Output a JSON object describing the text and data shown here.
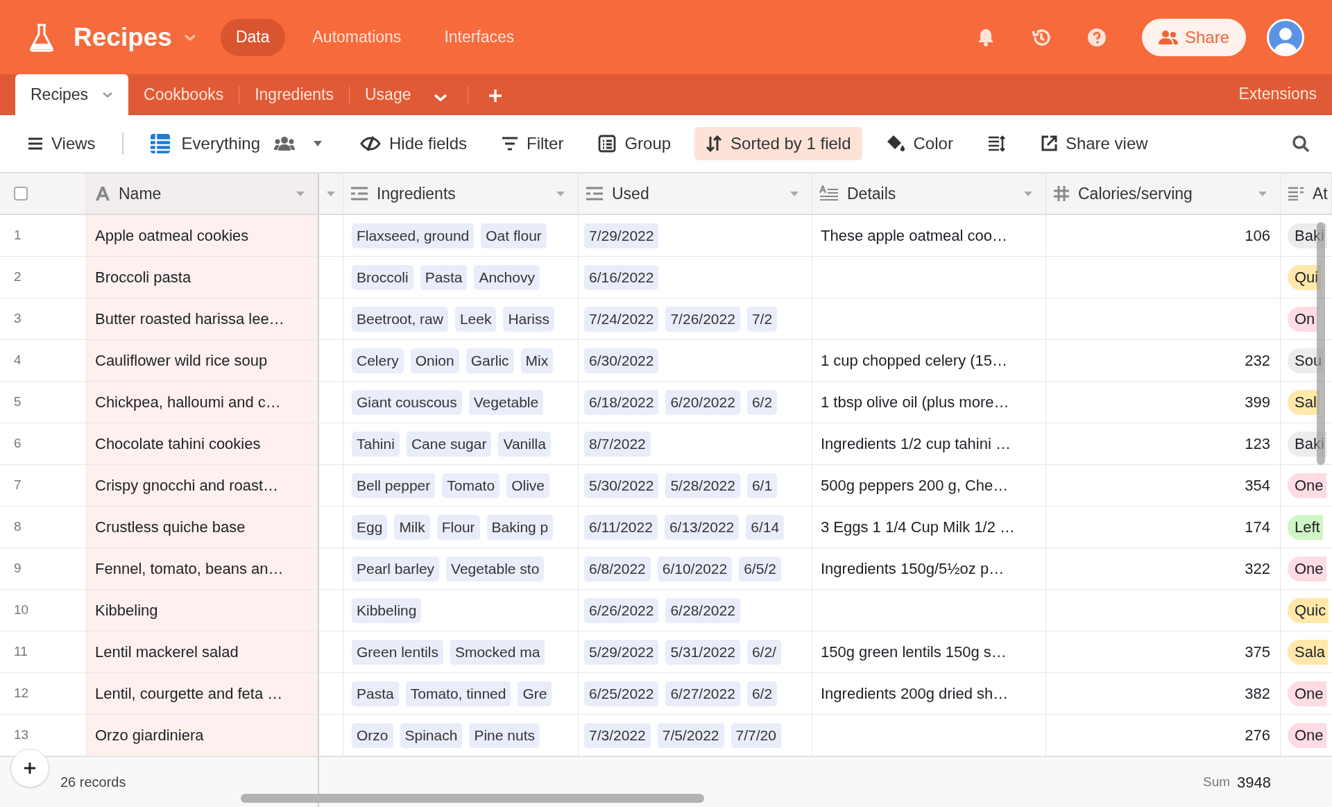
{
  "app": {
    "title": "Recipes",
    "nav": [
      {
        "label": "Data",
        "selected": true
      },
      {
        "label": "Automations",
        "selected": false
      },
      {
        "label": "Interfaces",
        "selected": false
      }
    ],
    "share_button": "Share"
  },
  "tables": [
    {
      "label": "Recipes",
      "selected": true
    },
    {
      "label": "Cookbooks",
      "selected": false
    },
    {
      "label": "Ingredients",
      "selected": false
    },
    {
      "label": "Usage",
      "selected": false
    }
  ],
  "extensions": "Extensions",
  "toolbar": {
    "views": "Views",
    "view_name": "Everything",
    "buttons": [
      {
        "kind": "hide",
        "label": "Hide fields",
        "active": false
      },
      {
        "kind": "filter",
        "label": "Filter",
        "active": false
      },
      {
        "kind": "group",
        "label": "Group",
        "active": false
      },
      {
        "kind": "sort",
        "label": "Sorted by 1 field",
        "active": true
      },
      {
        "kind": "color",
        "label": "Color",
        "active": false
      },
      {
        "kind": "row_height",
        "active": false
      },
      {
        "kind": "share",
        "label": "Share view",
        "active": false
      }
    ]
  },
  "table": {
    "select_all_checked": false,
    "columns": [
      {
        "name": "Name",
        "kind": "text"
      },
      {
        "name": "Ingredients",
        "kind": "link"
      },
      {
        "name": "Used",
        "kind": "link"
      },
      {
        "name": "Details",
        "kind": "longtext"
      },
      {
        "name": "Calories/serving",
        "kind": "number"
      },
      {
        "name": "At",
        "kind": "select"
      }
    ],
    "rows": [
      {
        "number": "1",
        "name": "Apple oatmeal cookies",
        "ingredients": [
          "Flaxseed, ground",
          "Oat flour"
        ],
        "used": [
          "7/29/2022"
        ],
        "details": "These apple oatmeal coo…",
        "calories": "106",
        "attribute": {
          "label": "Baki",
          "color": "#ececec"
        }
      },
      {
        "number": "2",
        "name": "Broccoli pasta",
        "ingredients": [
          "Broccoli",
          "Pasta",
          "Anchovy"
        ],
        "used": [
          "6/16/2022"
        ],
        "attribute": {
          "label": "Qui",
          "color": "#ffe8aa"
        }
      },
      {
        "number": "3",
        "name": "Butter roasted harissa lee…",
        "ingredients": [
          "Beetroot, raw",
          "Leek",
          "Hariss"
        ],
        "used": [
          "7/24/2022",
          "7/26/2022",
          "7/2"
        ],
        "attribute": {
          "label": "On",
          "color": "#ffdbe3"
        }
      },
      {
        "number": "4",
        "name": "Cauliflower wild rice soup",
        "ingredients": [
          "Celery",
          "Onion",
          "Garlic",
          "Mix"
        ],
        "used": [
          "6/30/2022"
        ],
        "details": "1 cup chopped celery (15…",
        "calories": "232",
        "attribute": {
          "label": "Sou",
          "color": "#ececec"
        }
      },
      {
        "number": "5",
        "name": "Chickpea, halloumi and c…",
        "ingredients": [
          "Giant couscous",
          "Vegetable"
        ],
        "used": [
          "6/18/2022",
          "6/20/2022",
          "6/2"
        ],
        "details": "1 tbsp olive oil (plus more…",
        "calories": "399",
        "attribute": {
          "label": "Sal",
          "color": "#ffe8aa"
        }
      },
      {
        "number": "6",
        "name": "Chocolate tahini cookies",
        "ingredients": [
          "Tahini",
          "Cane sugar",
          "Vanilla"
        ],
        "used": [
          "8/7/2022"
        ],
        "details": "Ingredients 1/2 cup tahini …",
        "calories": "123",
        "attribute": {
          "label": "Baki",
          "color": "#ececec"
        }
      },
      {
        "number": "7",
        "name": "Crispy gnocchi and roast…",
        "ingredients": [
          "Bell pepper",
          "Tomato",
          "Olive"
        ],
        "used": [
          "5/30/2022",
          "5/28/2022",
          "6/1"
        ],
        "details": "500g peppers 200 g, Che…",
        "calories": "354",
        "attribute": {
          "label": "One",
          "color": "#ffdbe3"
        }
      },
      {
        "number": "8",
        "name": "Crustless quiche base",
        "ingredients": [
          "Egg",
          "Milk",
          "Flour",
          "Baking p"
        ],
        "used": [
          "6/11/2022",
          "6/13/2022",
          "6/14"
        ],
        "details": "3 Eggs 1 1/4 Cup Milk 1/2 …",
        "calories": "174",
        "attribute": {
          "label": "Left",
          "color": "#d0f5c5"
        }
      },
      {
        "number": "9",
        "name": "Fennel, tomato, beans an…",
        "ingredients": [
          "Pearl barley",
          "Vegetable sto"
        ],
        "used": [
          "6/8/2022",
          "6/10/2022",
          "6/5/2"
        ],
        "details": "Ingredients 150g/5½oz p…",
        "calories": "322",
        "attribute": {
          "label": "One",
          "color": "#ffdbe3"
        }
      },
      {
        "number": "10",
        "name": "Kibbeling",
        "ingredients": [
          "Kibbeling"
        ],
        "used": [
          "6/26/2022",
          "6/28/2022"
        ],
        "attribute": {
          "label": "Quic",
          "color": "#ffe8aa"
        }
      },
      {
        "number": "11",
        "name": "Lentil mackerel salad",
        "ingredients": [
          "Green lentils",
          "Smocked ma"
        ],
        "used": [
          "5/29/2022",
          "5/31/2022",
          "6/2/"
        ],
        "details": "150g green lentils 150g s…",
        "calories": "375",
        "attribute": {
          "label": "Sala",
          "color": "#ffe8aa"
        }
      },
      {
        "number": "12",
        "name": "Lentil, courgette and feta …",
        "ingredients": [
          "Pasta",
          "Tomato, tinned",
          "Gre"
        ],
        "used": [
          "6/25/2022",
          "6/27/2022",
          "6/2"
        ],
        "details": "Ingredients 200g dried sh…",
        "calories": "382",
        "attribute": {
          "label": "One",
          "color": "#ffdbe3"
        }
      },
      {
        "number": "13",
        "name": "Orzo giardiniera",
        "ingredients": [
          "Orzo",
          "Spinach",
          "Pine nuts"
        ],
        "used": [
          "7/3/2022",
          "7/5/2022",
          "7/7/20"
        ],
        "calories": "276",
        "attribute": {
          "label": "One",
          "color": "#ffdbe3"
        }
      }
    ]
  },
  "footer": {
    "records": "26 records",
    "sum_label": "Sum",
    "sum": "3948"
  }
}
